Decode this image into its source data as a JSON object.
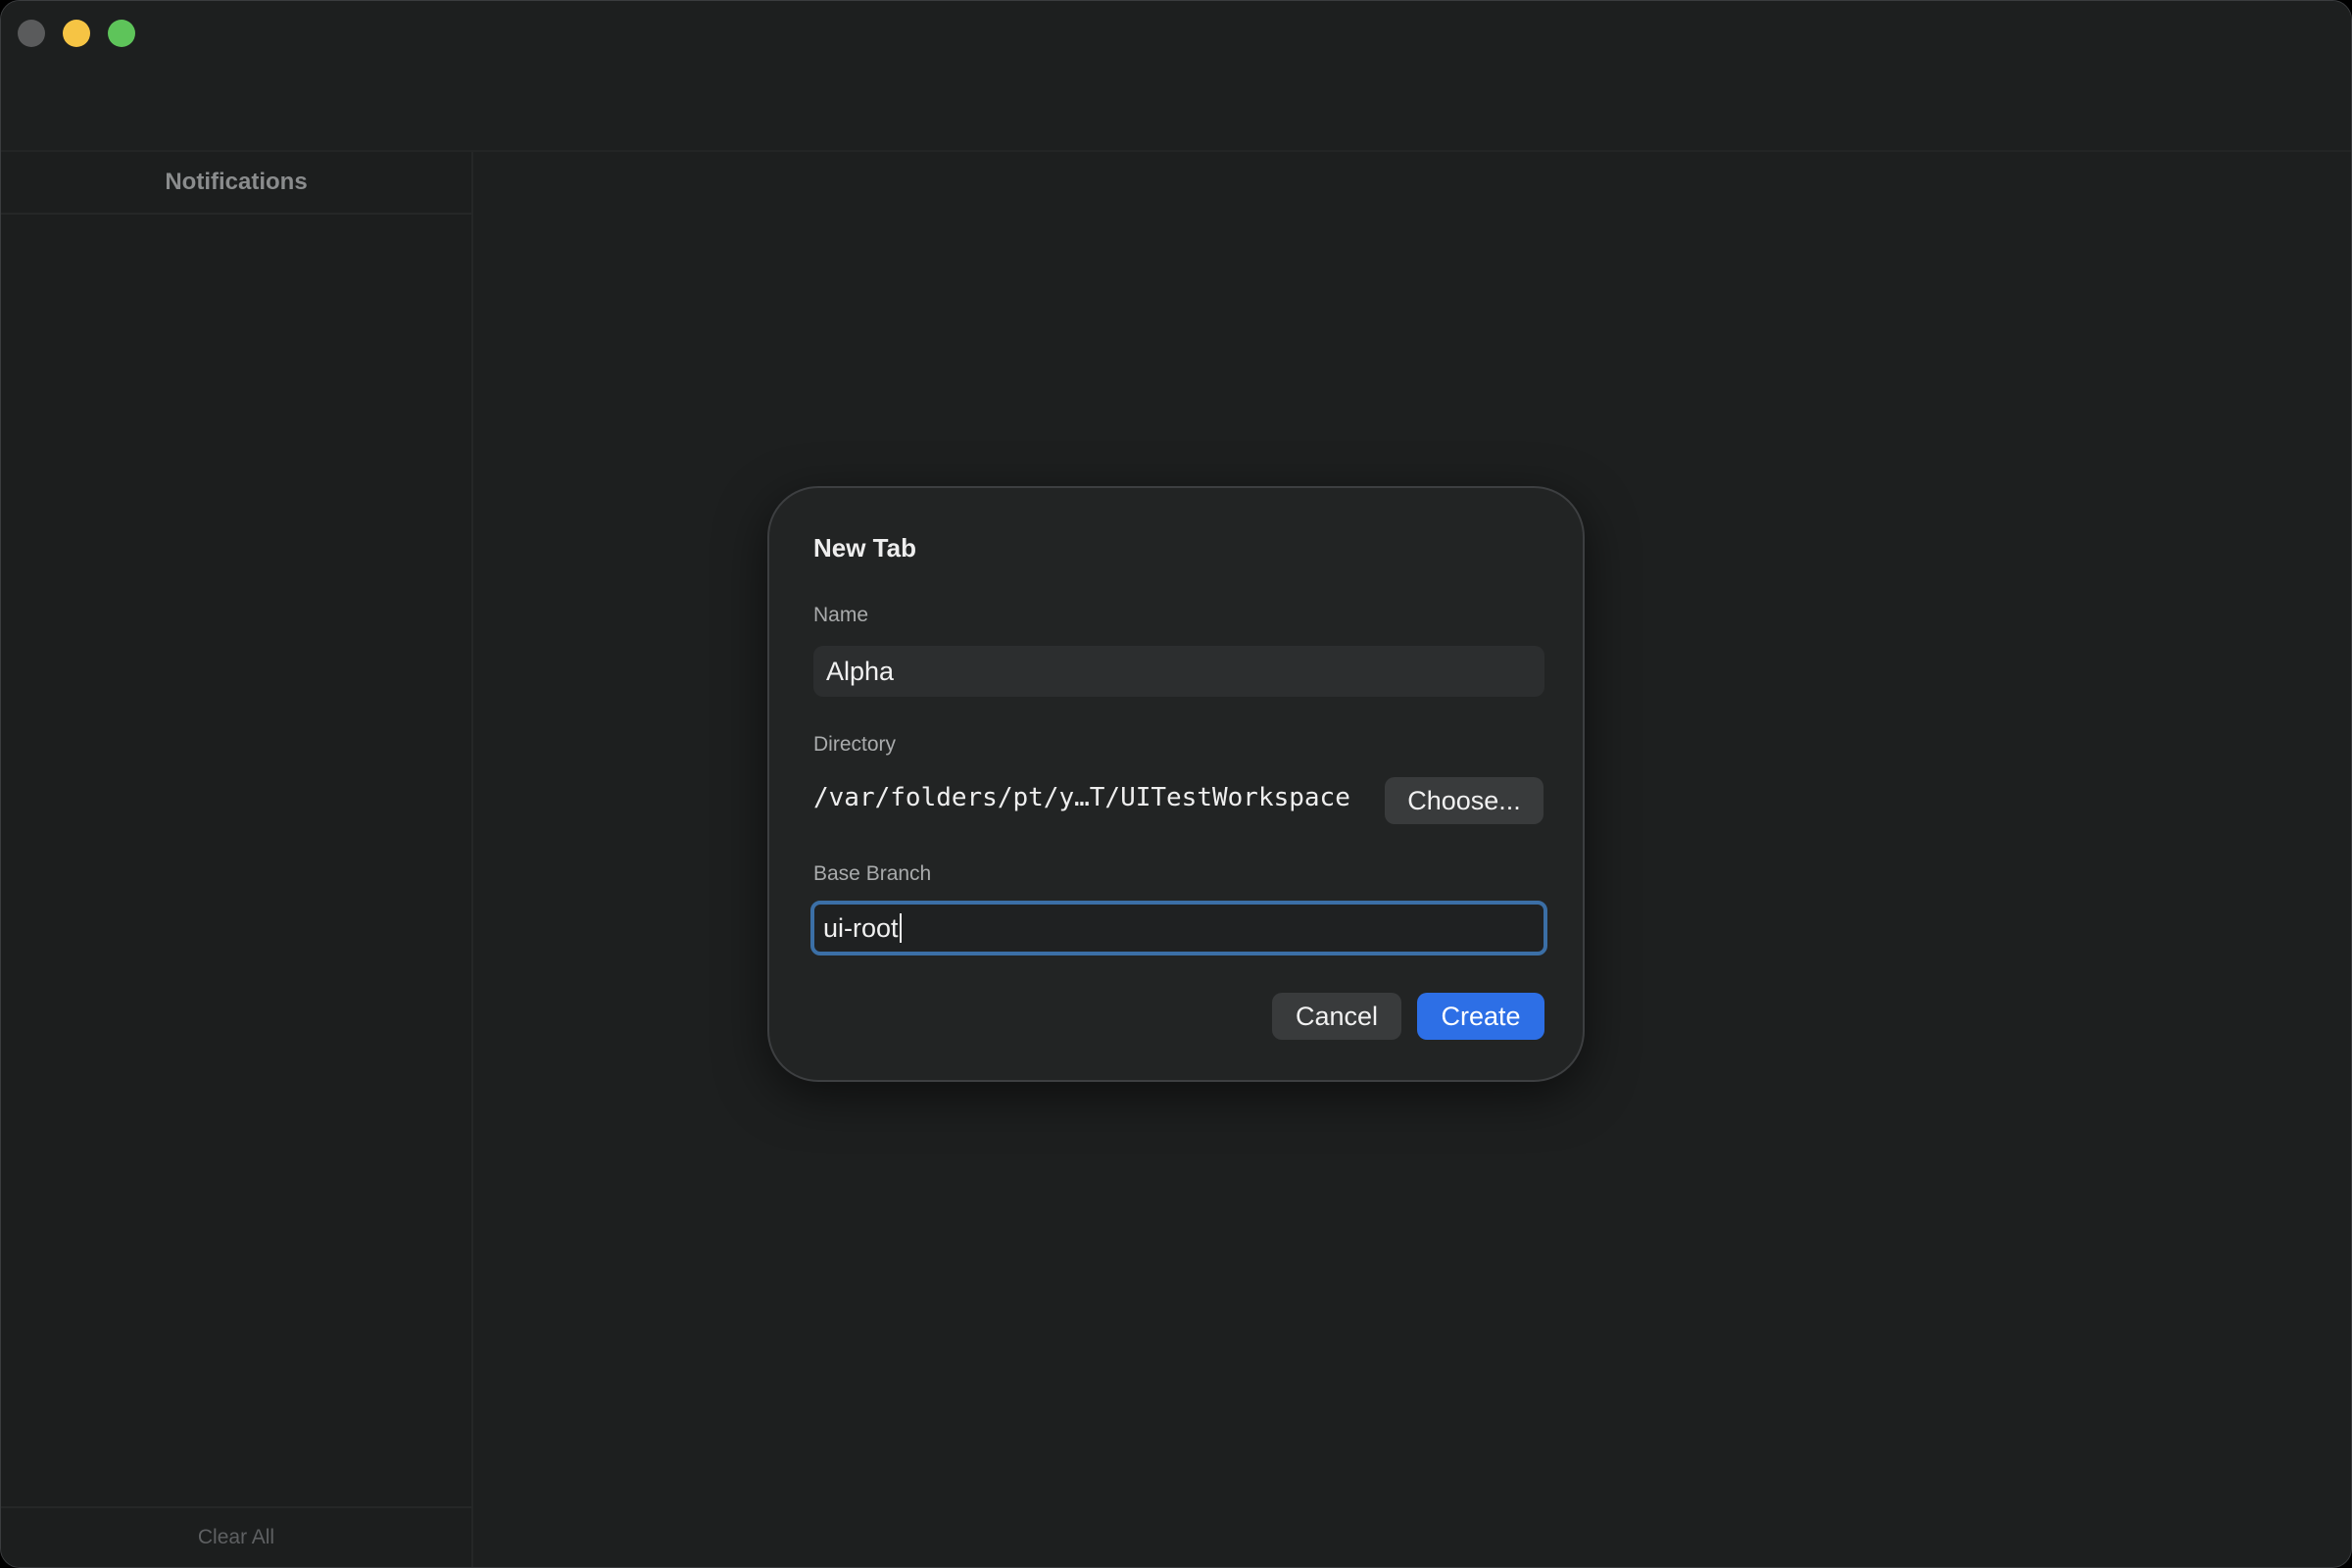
{
  "sidebar": {
    "title": "Notifications",
    "clear_all_label": "Clear All"
  },
  "dialog": {
    "title": "New Tab",
    "name_label": "Name",
    "name_value": "Alpha",
    "directory_label": "Directory",
    "directory_path": "/var/folders/pt/y…T/UITestWorkspace",
    "choose_label": "Choose...",
    "base_branch_label": "Base Branch",
    "base_branch_value": "ui-root",
    "cancel_label": "Cancel",
    "create_label": "Create"
  },
  "colors": {
    "window_bg": "#1d1f1f",
    "dialog_bg": "#222424",
    "accent_blue": "#2d6fe6",
    "focus_ring": "#3b6fa6",
    "traffic_close": "#5a5b5c",
    "traffic_minimize": "#f6c444",
    "traffic_zoom": "#5ec45a"
  }
}
